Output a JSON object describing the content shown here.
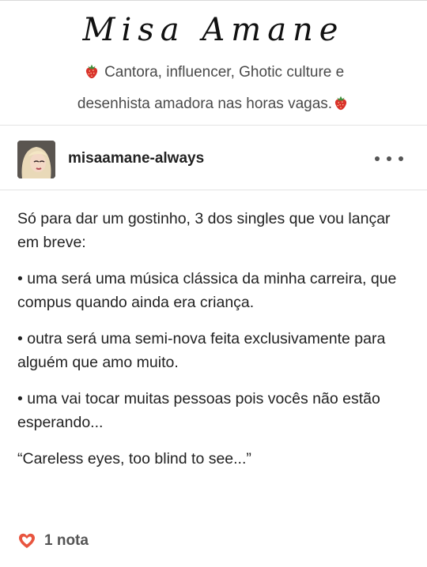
{
  "blog": {
    "title": "Misa Amane",
    "description_line1": "Cantora, influencer, Ghotic culture e",
    "description_line2": "desenhista amadora nas horas vagas."
  },
  "post": {
    "username": "misaamane-always",
    "paragraphs": [
      "Só para dar um gostinho, 3 dos singles que vou lançar em breve:",
      "• uma será uma música clássica da minha carreira, que compus quando ainda era criança.",
      "• outra será uma semi-nova feita exclusivamente para alguém que amo muito.",
      "• uma vai tocar muitas pessoas pois vocês não estão esperando...",
      "“Careless eyes, too blind to see...”"
    ],
    "notes_label": "1 nota"
  },
  "icons": {
    "strawberry": "strawberry-icon",
    "more": "more-options-icon",
    "heart": "heart-outline-icon"
  },
  "colors": {
    "heart": "#e8553f",
    "strawberry": "#d9322b",
    "text": "#222222",
    "muted": "#4a4a4a"
  }
}
